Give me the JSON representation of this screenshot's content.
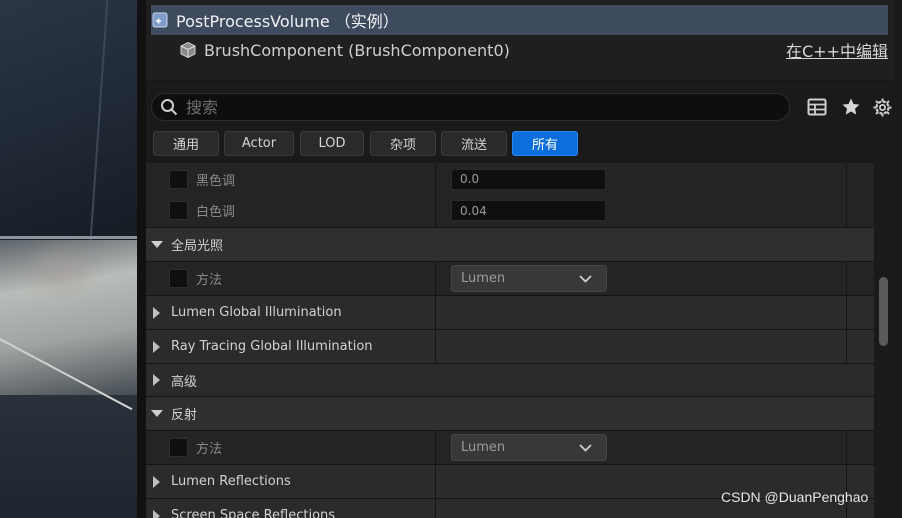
{
  "components": {
    "instance_label": "PostProcessVolume （实例）",
    "brush_label": "BrushComponent (BrushComponent0)",
    "edit_cpp_label": "在C++中编辑"
  },
  "search": {
    "placeholder": "搜索",
    "value": ""
  },
  "toolbar": {
    "icons": [
      "table-view-icon",
      "star-icon",
      "gear-icon"
    ]
  },
  "tabs": [
    {
      "label": "通用",
      "active": false
    },
    {
      "label": "Actor",
      "active": false
    },
    {
      "label": "LOD",
      "active": false
    },
    {
      "label": "杂项",
      "active": false
    },
    {
      "label": "流送",
      "active": false
    },
    {
      "label": "所有",
      "active": true
    }
  ],
  "properties": {
    "black_tone": {
      "label": "黑色调",
      "value": "0.0"
    },
    "white_tone": {
      "label": "白色调",
      "value": "0.04"
    },
    "gi_category": {
      "label": "全局光照"
    },
    "gi_method": {
      "label": "方法",
      "value": "Lumen"
    },
    "lumen_gi": {
      "label": "Lumen Global Illumination"
    },
    "rt_gi": {
      "label": "Ray Tracing Global Illumination"
    },
    "advanced": {
      "label": "高级"
    },
    "reflection_category": {
      "label": "反射"
    },
    "reflection_method": {
      "label": "方法",
      "value": "Lumen"
    },
    "lumen_reflections": {
      "label": "Lumen Reflections"
    },
    "ssr": {
      "label": "Screen Space Reflections"
    }
  },
  "watermark": "CSDN @DuanPenghao",
  "colors": {
    "accent": "#0c6edb",
    "selected_row": "#3e4b5f",
    "panel_bg": "#1a1a1a"
  }
}
